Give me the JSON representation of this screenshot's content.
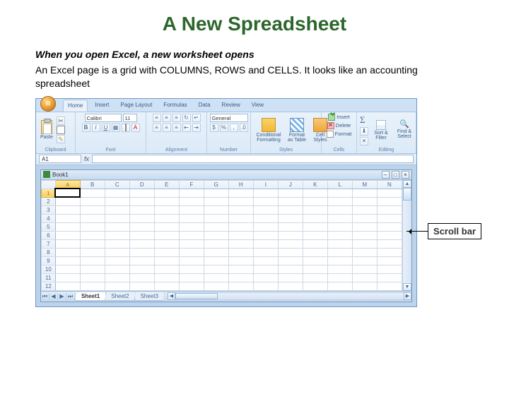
{
  "slide": {
    "title": "A New Spreadsheet",
    "heading": "When you open Excel, a new worksheet opens",
    "body": "An Excel page is a grid with COLUMNS, ROWS and CELLS. It looks like an accounting spreadsheet"
  },
  "ribbon": {
    "tabs": [
      "Home",
      "Insert",
      "Page Layout",
      "Formulas",
      "Data",
      "Review",
      "View"
    ],
    "active_tab": "Home",
    "clipboard": {
      "label": "Clipboard",
      "paste": "Paste"
    },
    "font": {
      "label": "Font",
      "name": "Calibri",
      "size": "11"
    },
    "alignment": {
      "label": "Alignment"
    },
    "number": {
      "label": "Number",
      "format": "General"
    },
    "styles": {
      "label": "Styles",
      "cond": "Conditional Formatting",
      "table": "Format as Table",
      "cell": "Cell Styles"
    },
    "cells": {
      "label": "Cells",
      "insert": "Insert",
      "delete": "Delete",
      "format": "Format"
    },
    "editing": {
      "label": "Editing",
      "sort": "Sort & Filter",
      "find": "Find & Select"
    }
  },
  "formula_bar": {
    "name_box": "A1"
  },
  "workbook": {
    "title": "Book1",
    "columns": [
      "A",
      "B",
      "C",
      "D",
      "E",
      "F",
      "G",
      "H",
      "I",
      "J",
      "K",
      "L",
      "M",
      "N"
    ],
    "rows": [
      1,
      2,
      3,
      4,
      5,
      6,
      7,
      8,
      9,
      10,
      11,
      12
    ],
    "active_cell": "A1",
    "sheets": [
      "Sheet1",
      "Sheet2",
      "Sheet3"
    ],
    "active_sheet": "Sheet1"
  },
  "callout": {
    "label": "Scroll bar"
  }
}
